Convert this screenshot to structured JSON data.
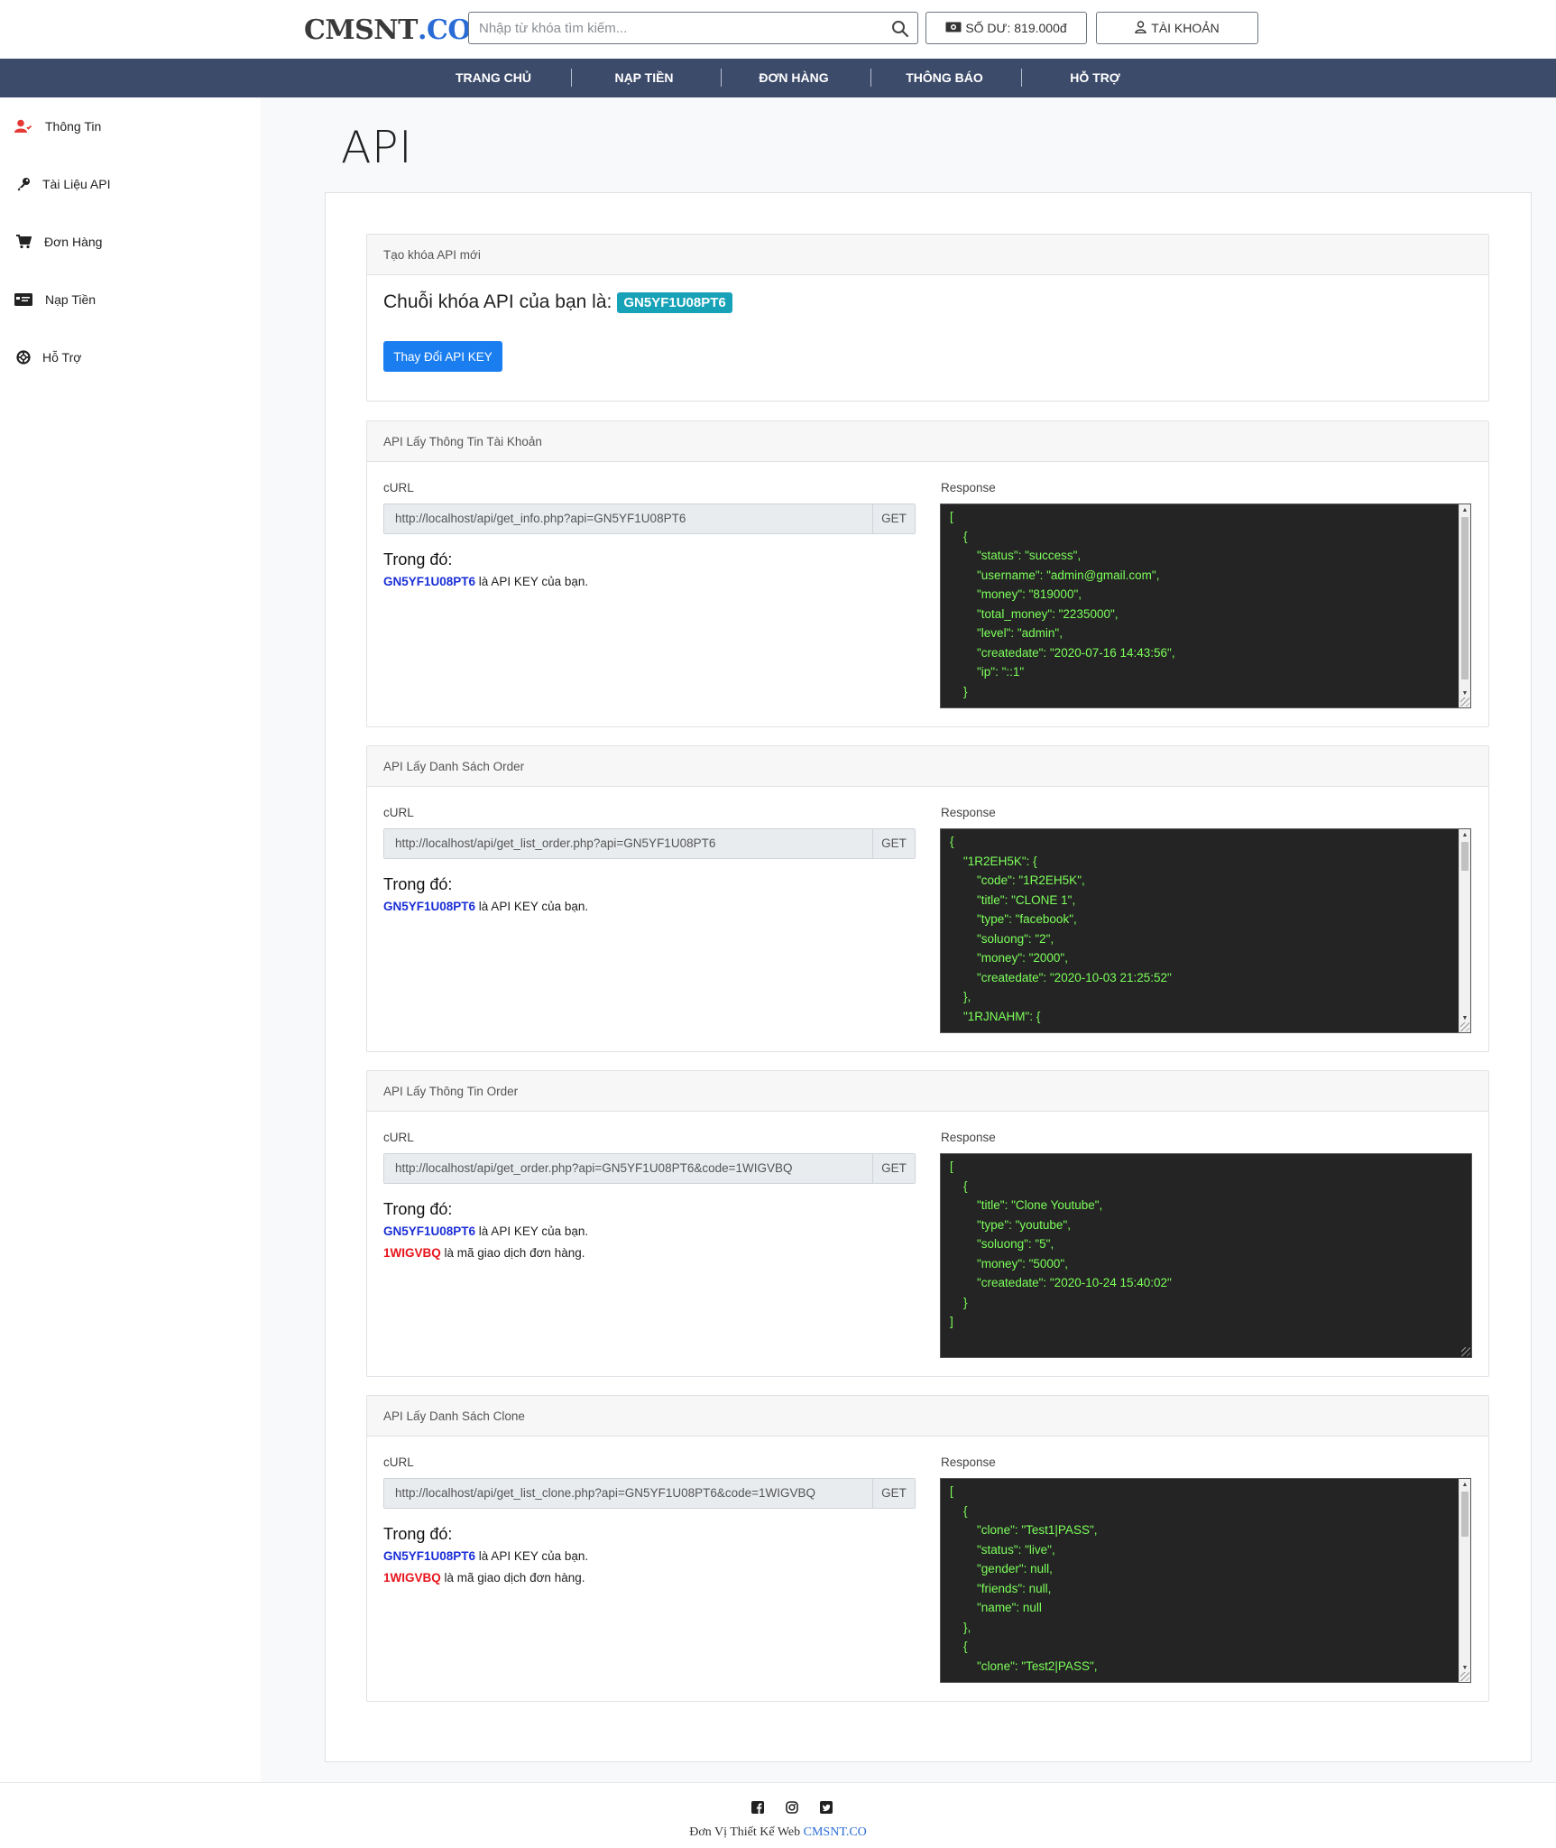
{
  "header": {
    "logo": {
      "part1": "CMSNT",
      "part2": ".CO"
    },
    "search": {
      "placeholder": "Nhập từ khóa tìm kiếm..."
    },
    "balance_label": "SỐ DƯ: 819.000đ",
    "account_label": "TÀI KHOẢN"
  },
  "nav": {
    "items": [
      {
        "label": "TRANG CHỦ"
      },
      {
        "label": "NẠP TIỀN"
      },
      {
        "label": "ĐƠN HÀNG"
      },
      {
        "label": "THÔNG BÁO"
      },
      {
        "label": "HỖ TRỢ"
      }
    ]
  },
  "sidebar": {
    "items": [
      {
        "label": "Thông Tin",
        "icon": "user-icon"
      },
      {
        "label": "Tài Liệu API",
        "icon": "key-icon"
      },
      {
        "label": "Đơn Hàng",
        "icon": "cart-icon"
      },
      {
        "label": "Nạp Tiền",
        "icon": "money-card-icon"
      },
      {
        "label": "Hỗ Trợ",
        "icon": "life-ring-icon"
      }
    ]
  },
  "page": {
    "title": "API"
  },
  "api_key_card": {
    "header": "Tạo khóa API mới",
    "key_text": "Chuỗi khóa API của bạn là:",
    "key_value": "GN5YF1U08PT6",
    "change_button": "Thay Đổi API KEY"
  },
  "labels": {
    "curl": "cURL",
    "response": "Response",
    "where": "Trong đó:",
    "method": "GET"
  },
  "colors": {
    "nav_bg": "#3d4b6b",
    "badge": "#17a2b8",
    "primary": "#1a7ef0",
    "json_text": "#7cff5a",
    "key_blue": "#1a2ed6",
    "key_red": "#e8141c"
  },
  "sections": [
    {
      "header": "API Lấy Thông Tin Tài Khoản",
      "curl": "http://localhost/api/get_info.php?api=GN5YF1U08PT6",
      "where": [
        {
          "key": "GN5YF1U08PT6",
          "color": "blue",
          "text": " là API KEY của bạn."
        }
      ],
      "response": "[\n    {\n        \"status\": \"success\",\n        \"username\": \"admin@gmail.com\",\n        \"money\": \"819000\",\n        \"total_money\": \"2235000\",\n        \"level\": \"admin\",\n        \"createdate\": \"2020-07-16 14:43:56\",\n        \"ip\": \"::1\"\n    }",
      "scrollbar": true
    },
    {
      "header": "API Lấy Danh Sách Order",
      "curl": "http://localhost/api/get_list_order.php?api=GN5YF1U08PT6",
      "where": [
        {
          "key": "GN5YF1U08PT6",
          "color": "blue",
          "text": " là API KEY của bạn."
        }
      ],
      "response": "{\n    \"1R2EH5K\": {\n        \"code\": \"1R2EH5K\",\n        \"title\": \"CLONE 1\",\n        \"type\": \"facebook\",\n        \"soluong\": \"2\",\n        \"money\": \"2000\",\n        \"createdate\": \"2020-10-03 21:25:52\"\n    },\n    \"1RJNAHM\": {",
      "scrollbar": true
    },
    {
      "header": "API Lấy Thông Tin Order",
      "curl": "http://localhost/api/get_order.php?api=GN5YF1U08PT6&code=1WIGVBQ",
      "where": [
        {
          "key": "GN5YF1U08PT6",
          "color": "blue",
          "text": " là API KEY của bạn."
        },
        {
          "key": "1WIGVBQ",
          "color": "red",
          "text": " là mã giao dịch đơn hàng."
        }
      ],
      "response": "[\n    {\n        \"title\": \"Clone Youtube\",\n        \"type\": \"youtube\",\n        \"soluong\": \"5\",\n        \"money\": \"5000\",\n        \"createdate\": \"2020-10-24 15:40:02\"\n    }\n]",
      "scrollbar": false
    },
    {
      "header": "API Lấy Danh Sách Clone",
      "curl": "http://localhost/api/get_list_clone.php?api=GN5YF1U08PT6&code=1WIGVBQ",
      "where": [
        {
          "key": "GN5YF1U08PT6",
          "color": "blue",
          "text": " là API KEY của bạn."
        },
        {
          "key": "1WIGVBQ",
          "color": "red",
          "text": " là mã giao dịch đơn hàng."
        }
      ],
      "response": "[\n    {\n        \"clone\": \"Test1|PASS\",\n        \"status\": \"live\",\n        \"gender\": null,\n        \"friends\": null,\n        \"name\": null\n    },\n    {\n        \"clone\": \"Test2|PASS\",",
      "scrollbar": true
    }
  ],
  "footer": {
    "credit_text": "Đơn Vị Thiết Kế Web ",
    "credit_link": "CMSNT.CO"
  }
}
